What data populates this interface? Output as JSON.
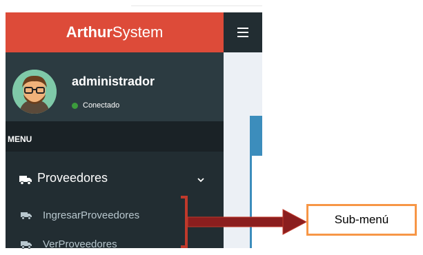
{
  "brand": {
    "bold": "Arthur",
    "rest": "System",
    "color": "#dd4b39"
  },
  "user": {
    "name": "administrador",
    "status": "Conectado"
  },
  "menu": {
    "header": "MENU",
    "tree": {
      "label": "Proveedores",
      "icon": "truck-icon",
      "subitems": [
        {
          "label": "IngresarProveedores",
          "icon": "truck-icon"
        },
        {
          "label": "VerProveedores",
          "icon": "truck-icon"
        }
      ]
    }
  },
  "annotation": {
    "label": "Sub-menú",
    "border_color": "#f79646",
    "arrow_color": "#8b1e1e"
  },
  "colors": {
    "sidebar": "#222d32",
    "userpanel": "#2c3b41",
    "accent": "#3c8dbc",
    "content_bg": "#ecf0f5"
  }
}
